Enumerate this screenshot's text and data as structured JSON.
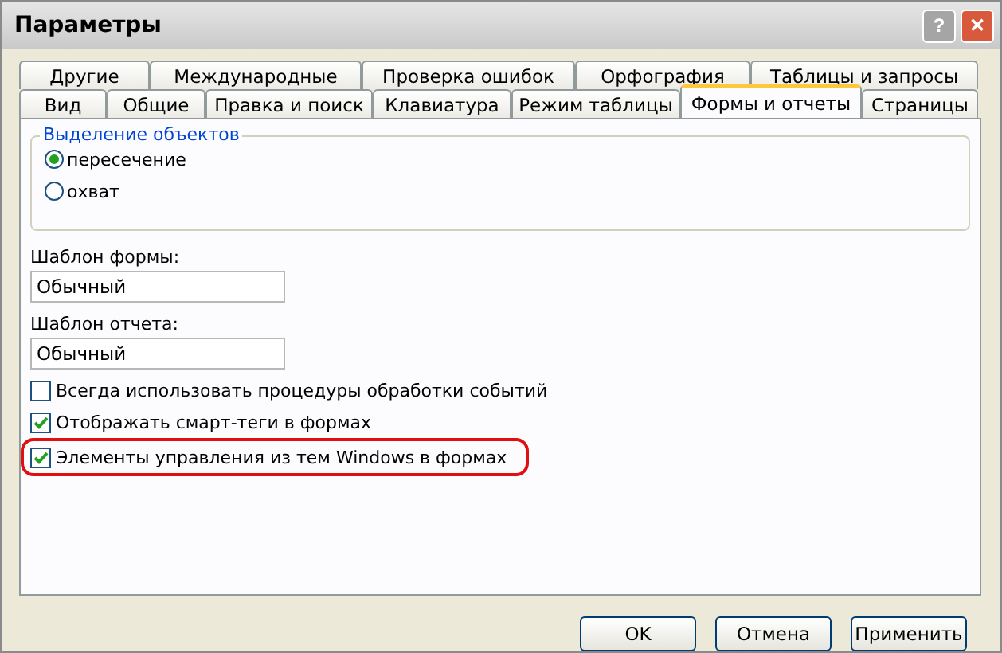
{
  "window": {
    "title": "Параметры",
    "buttons": [
      {
        "kind": "help",
        "label": "?"
      },
      {
        "kind": "close",
        "label": "✕"
      }
    ]
  },
  "tab_rows": [
    [
      {
        "label": "Другие",
        "selected": false
      },
      {
        "label": "Международные",
        "selected": false
      },
      {
        "label": "Проверка ошибок",
        "selected": false
      },
      {
        "label": "Орфография",
        "selected": false
      },
      {
        "label": "Таблицы и запросы",
        "selected": false
      }
    ],
    [
      {
        "label": "Вид",
        "selected": false
      },
      {
        "label": "Общие",
        "selected": false
      },
      {
        "label": "Правка и поиск",
        "selected": false
      },
      {
        "label": "Клавиатура",
        "selected": false
      },
      {
        "label": "Режим таблицы",
        "selected": false
      },
      {
        "label": "Формы и отчеты",
        "selected": true
      },
      {
        "label": "Страницы",
        "selected": false
      }
    ]
  ],
  "object_selection": {
    "title": "Выделение объектов",
    "options": [
      {
        "label": "пересечение",
        "selected": true
      },
      {
        "label": "охват",
        "selected": false
      }
    ]
  },
  "fields": [
    {
      "label": "Шаблон формы:",
      "value": "Обычный"
    },
    {
      "label": "Шаблон отчета:",
      "value": "Обычный"
    }
  ],
  "checkboxes": [
    {
      "label": "Всегда использовать процедуры обработки событий",
      "checked": false,
      "highlighted": false
    },
    {
      "label": "Отображать смарт-теги в формах",
      "checked": true,
      "highlighted": false
    },
    {
      "label": "Элементы управления из тем Windows в формах",
      "checked": true,
      "highlighted": true
    }
  ],
  "buttons": [
    "OK",
    "Отмена",
    "Применить"
  ]
}
